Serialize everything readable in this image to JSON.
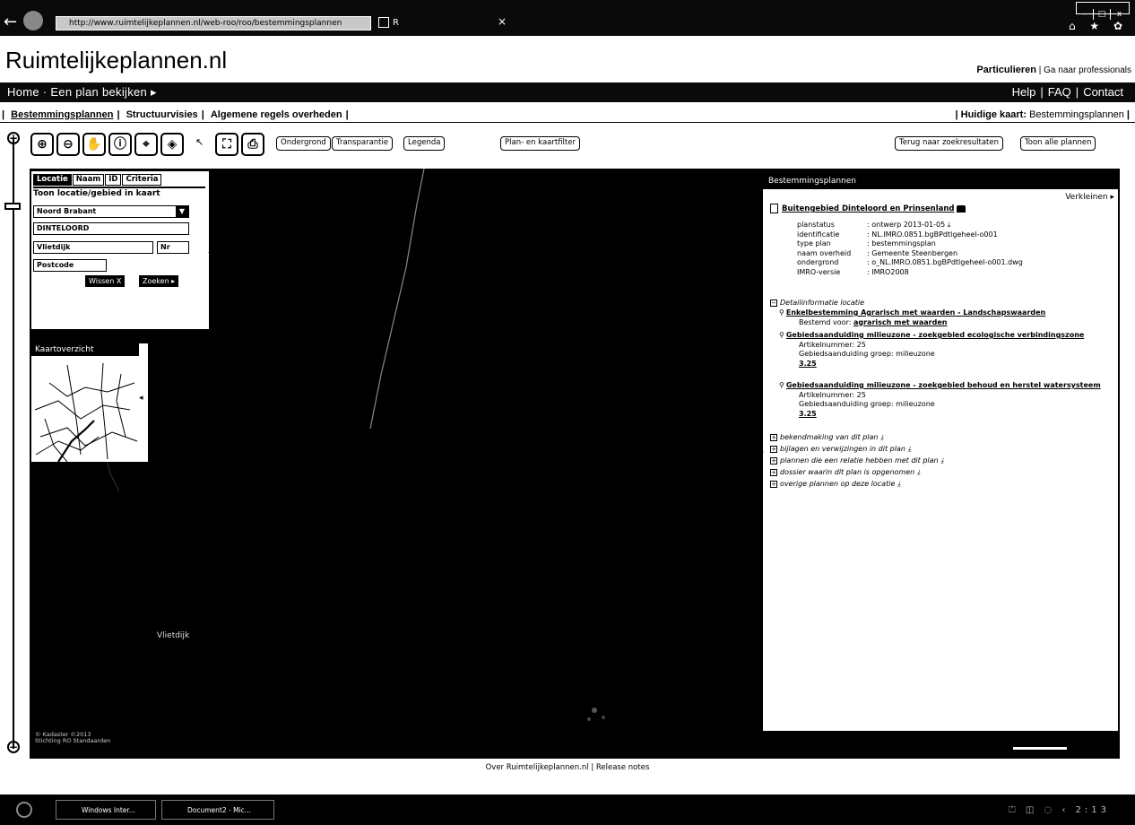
{
  "browser": {
    "address": "http://www.ruimtelijkeplannen.nl/web-roo/roo/bestemmingsplannen",
    "tab_label": "R",
    "tab_close": "×",
    "window_controls": [
      "–",
      "□",
      "x"
    ],
    "toolbar_icons": "⌂ ★ ✿"
  },
  "site": {
    "title": "Ruimtelijkeplannen.nl",
    "user_current": "Particulieren",
    "user_separator": "|",
    "user_switch": "Ga naar professionals"
  },
  "nav": {
    "breadcrumb": "Home · Een plan bekijken ▸",
    "help": "Help",
    "faq": "FAQ",
    "contact": "Contact"
  },
  "subnav": {
    "tabs": [
      "Bestemmingsplannen",
      "Structuurvisies",
      "Algemene regels overheden"
    ],
    "current_map_label": "Huidige kaart:",
    "current_map_value": "Bestemmingsplannen"
  },
  "zoom": {
    "plus": "+",
    "minus": "−"
  },
  "toolbar": {
    "icons": [
      "zoom-in-icon",
      "zoom-out-icon",
      "pan-hand-icon",
      "info-icon",
      "measure-icon",
      "locate-icon",
      "cursor-icon",
      "fullscreen-icon",
      "print-icon"
    ],
    "ondergrond": "Ondergrond",
    "transparantie": "Transparantie",
    "legenda": "Legenda",
    "plan_kaartfilter": "Plan- en kaartfilter",
    "terug": "Terug naar zoekresultaten",
    "toon_alle": "Toon alle plannen"
  },
  "search": {
    "tabs": [
      "Locatie",
      "Naam",
      "ID",
      "Criteria"
    ],
    "caption": "Toon locatie/gebied in kaart",
    "province": "Noord Brabant",
    "place": "DINTELOORD",
    "street": "Vlietdijk",
    "number_placeholder": "Nr",
    "postcode_placeholder": "Postcode",
    "clear_button": "Wissen X",
    "search_button": "Zoeken ▸"
  },
  "overview": {
    "title": "Kaartoverzicht"
  },
  "map": {
    "place_label": "Vlietdijk",
    "copyright_1": "© Kadaster ©2013",
    "copyright_2": "Stichting RO Standaarden"
  },
  "info": {
    "header": "Bestemmingsplannen",
    "shrink": "Verkleinen ▸",
    "plan_title": "Buitengebied Dinteloord en Prinsenland",
    "props": [
      {
        "k": "planstatus",
        "v": ": ontwerp 2013-01-05  ⤓"
      },
      {
        "k": "identificatie",
        "v": ": NL.IMRO.0851.bgBPdtlgeheel-o001"
      },
      {
        "k": "type plan",
        "v": ": bestemmingsplan"
      },
      {
        "k": "naam overheid",
        "v": ": Gemeente Steenbergen"
      },
      {
        "k": "ondergrond",
        "v": ": o_NL.IMRO.0851.bgBPdtlgeheel-o001.dwg"
      },
      {
        "k": "IMRO-versie",
        "v": ": IMRO2008"
      }
    ],
    "detail_head": "Detailinformatie locatie",
    "sections": [
      {
        "title": "Enkelbestemming Agrarisch met waarden - Landschapswaarden",
        "l1": "Bestemd voor:",
        "l1b": "agrarisch met waarden"
      },
      {
        "title": "Gebiedsaanduiding milieuzone - zoekgebied ecologische verbindingszone",
        "l1": "Artikelnummer: 25",
        "l2": "Gebiedsaanduiding groep: milieuzone",
        "l3": "3.25"
      },
      {
        "title": "Gebiedsaanduiding milieuzone - zoekgebied behoud en herstel watersysteem",
        "l1": "Artikelnummer: 25",
        "l2": "Gebiedsaanduiding groep: milieuzone",
        "l3": "3.25"
      }
    ],
    "more": [
      "bekendmaking van dit plan  ⤓",
      "bijlagen en verwijzingen in dit plan  ⤓",
      "plannen die een relatie hebben met dit plan  ⤓",
      "dossier waarin dit plan is opgenomen  ⤓",
      "overige plannen op deze locatie  ⤓"
    ]
  },
  "footer": {
    "text": "Over Ruimtelijkeplannen.nl | Release notes"
  },
  "taskbar": {
    "items": [
      "Windows Inter...",
      "Document2 - Mic..."
    ],
    "tray": "⏍ ◫ ◌ ‹ 2:13"
  }
}
